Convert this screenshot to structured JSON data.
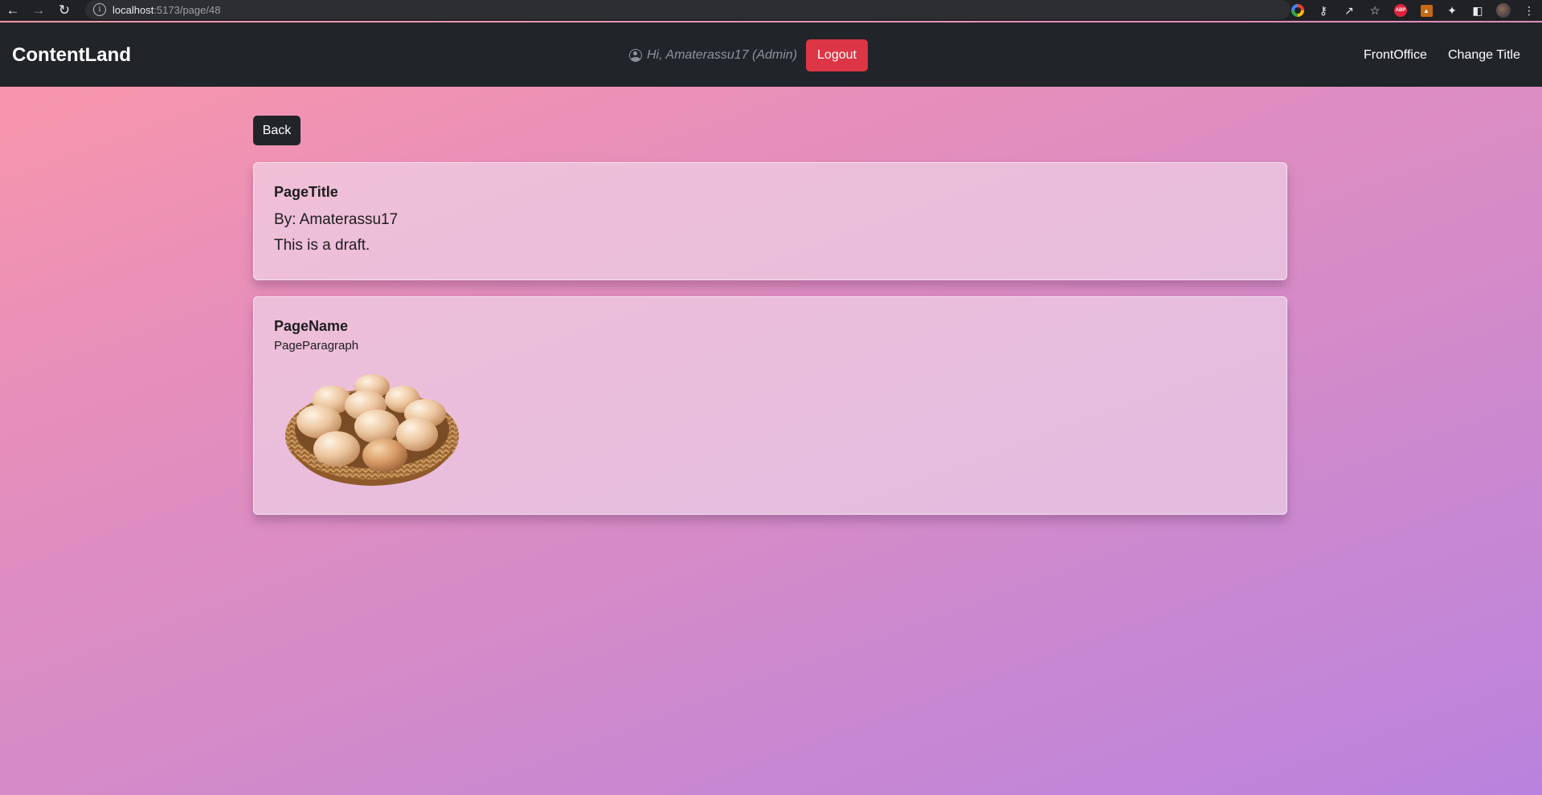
{
  "browser": {
    "url_host": "localhost",
    "url_path": ":5173/page/48"
  },
  "navbar": {
    "brand": "ContentLand",
    "greeting": "Hi, Amaterassu17 (Admin)",
    "logout_label": "Logout",
    "links": [
      "FrontOffice",
      "Change Title"
    ]
  },
  "content": {
    "back_label": "Back",
    "header_card": {
      "title": "PageTitle",
      "author": "By: Amaterassu17",
      "status": "This is a draft."
    },
    "body_card": {
      "name": "PageName",
      "paragraph": "PageParagraph",
      "image": "egg-basket-image"
    }
  },
  "colors": {
    "navbar": "#212529",
    "logout": "#dc3545",
    "gradient_start": "#fd97a8",
    "gradient_end": "#ba82de"
  }
}
